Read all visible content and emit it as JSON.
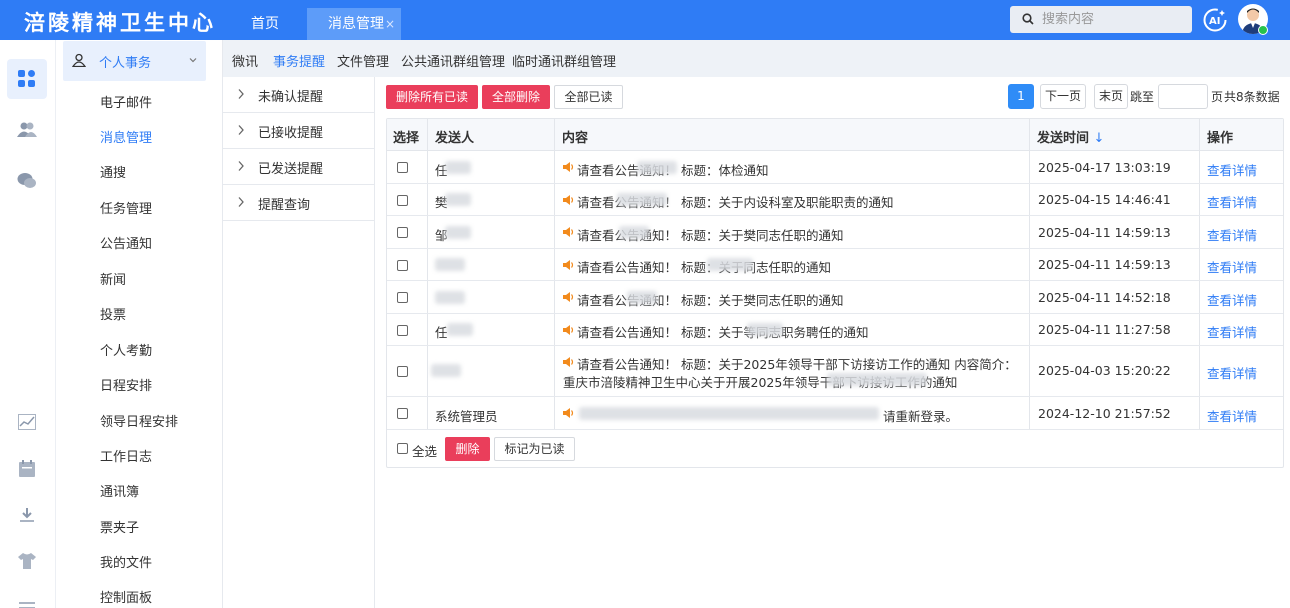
{
  "app": {
    "title": "涪陵精神卫生中心"
  },
  "top_tabs": [
    {
      "label": "首页"
    },
    {
      "label": "消息管理",
      "close": "×"
    }
  ],
  "search": {
    "placeholder": "搜索内容"
  },
  "ai_label": "AI",
  "icons": {
    "rail": [
      "grid-icon",
      "users-icon",
      "chat-icon",
      "chart-icon",
      "calendar-icon",
      "download-icon",
      "shirt-icon",
      "list-icon"
    ]
  },
  "colors": {
    "brand": "#2f7cf5",
    "danger": "#ea3e5b",
    "online": "#27c24c"
  },
  "sidebar": {
    "group": "个人事务",
    "items": [
      {
        "label": "电子邮件"
      },
      {
        "label": "消息管理"
      },
      {
        "label": "通搜"
      },
      {
        "label": "任务管理"
      },
      {
        "label": "公告通知"
      },
      {
        "label": "新闻"
      },
      {
        "label": "投票"
      },
      {
        "label": "个人考勤"
      },
      {
        "label": "日程安排"
      },
      {
        "label": "领导日程安排"
      },
      {
        "label": "工作日志"
      },
      {
        "label": "通讯簿"
      },
      {
        "label": "票夹子"
      },
      {
        "label": "我的文件"
      },
      {
        "label": "控制面板"
      }
    ]
  },
  "subnav": [
    "微讯",
    "事务提醒",
    "文件管理",
    "公共通讯群组管理",
    "临时通讯群组管理"
  ],
  "tree": [
    "未确认提醒",
    "已接收提醒",
    "已发送提醒",
    "提醒查询"
  ],
  "toolbar": {
    "delete_read": "删除所有已读",
    "delete_all": "全部删除",
    "mark_all_read": "全部已读"
  },
  "pager": {
    "current": "1",
    "next": "下一页",
    "last": "末页",
    "jump": "跳至",
    "page_suffix": "页",
    "total": "共8条数据"
  },
  "table": {
    "headers": {
      "select": "选择",
      "sender": "发送人",
      "content": "内容",
      "time": "发送时间",
      "time_sort": "↓",
      "action": "操作"
    },
    "rows": [
      {
        "sender": "任",
        "content": "请查看公告通知！ 标题：体检通知",
        "content2": "",
        "time": "2025-04-17 13:03:19",
        "action": "查看详情"
      },
      {
        "sender": "樊",
        "content": "请查看公告通知！ 标题：关于内设科室及职能职责的通知",
        "content2": "",
        "time": "2025-04-15 14:46:41",
        "action": "查看详情"
      },
      {
        "sender": "邹",
        "content": "请查看公告通知！ 标题：关于樊同志任职的通知",
        "content2": "",
        "time": "2025-04-11 14:59:13",
        "action": "查看详情"
      },
      {
        "sender": "",
        "content": "请查看公告通知！ 标题：关于同志任职的通知",
        "content2": "",
        "time": "2025-04-11 14:59:13",
        "action": "查看详情"
      },
      {
        "sender": "",
        "content": "请查看公告通知！ 标题：关于樊同志任职的通知",
        "content2": "",
        "time": "2025-04-11 14:52:18",
        "action": "查看详情"
      },
      {
        "sender": "任",
        "content": "请查看公告通知！ 标题：关于等同志职务聘任的通知",
        "content2": "",
        "time": "2025-04-11 11:27:58",
        "action": "查看详情"
      },
      {
        "sender": "",
        "content": "请查看公告通知！ 标题：关于2025年领导干部下访接访工作的通知 内容简介：",
        "content2": "重庆市涪陵精神卫生中心关于开展2025年领导干部下访接访工作的通知",
        "time": "2025-04-03 15:20:22",
        "action": "查看详情"
      },
      {
        "sender": "系统管理员",
        "content": "请重新登录。",
        "content2": "",
        "time": "2024-12-10 21:57:52",
        "action": "查看详情"
      }
    ],
    "footer": {
      "select_all": "全选",
      "delete": "删除",
      "mark_read": "标记为已读"
    }
  }
}
